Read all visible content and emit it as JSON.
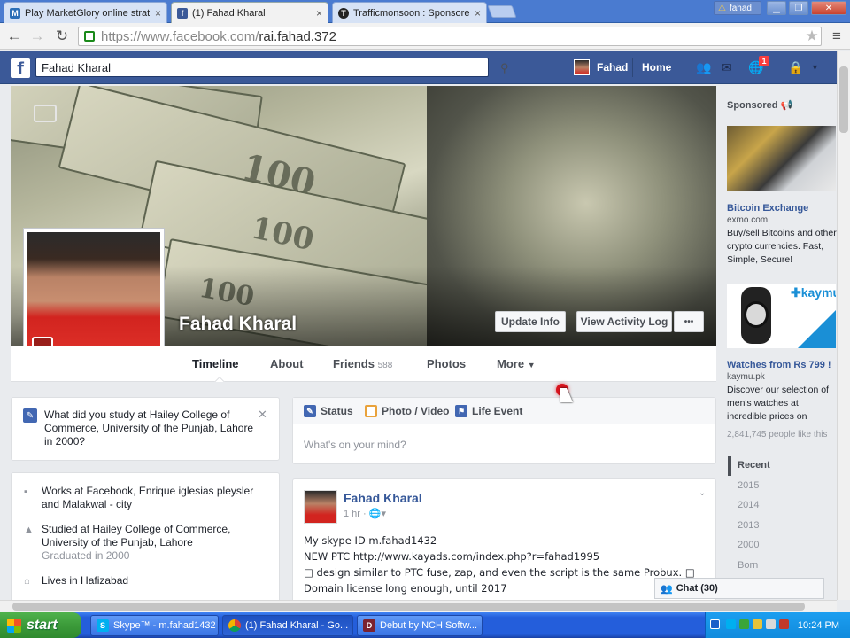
{
  "browser": {
    "tabs": [
      {
        "title": "Play MarketGlory online strat",
        "icon": "marketglory-favicon"
      },
      {
        "title": "(1) Fahad Kharal",
        "icon": "facebook-favicon",
        "active": true
      },
      {
        "title": "Trafficmonsoon : Sponsored",
        "icon": "trafficmonsoon-favicon"
      }
    ],
    "user_badge": "fahad",
    "url_scheme": "https://www.facebook.com/",
    "url_path": "rai.fahad.372"
  },
  "fb": {
    "search_value": "Fahad Kharal",
    "nav_user": "Fahad",
    "nav_home": "Home",
    "notif_count": "1"
  },
  "profile": {
    "name": "Fahad Kharal",
    "update_info": "Update Info",
    "view_activity_log": "View Activity Log",
    "more_dots": "•••",
    "tabs": [
      {
        "label": "Timeline",
        "count": ""
      },
      {
        "label": "About",
        "count": ""
      },
      {
        "label": "Friends",
        "count": "588"
      },
      {
        "label": "Photos",
        "count": ""
      },
      {
        "label": "More",
        "count": ""
      }
    ]
  },
  "intro": {
    "question": "What did you study at Hailey College of Commerce, University of the Punjab, Lahore in 2000?",
    "about": [
      {
        "text": "Works at Facebook, Enrique iglesias pleysler and Malakwal - city",
        "sub": ""
      },
      {
        "text": "Studied at Hailey College of Commerce, University of the Punjab, Lahore",
        "sub": "Graduated in 2000"
      },
      {
        "text": "Lives in Hafizabad",
        "sub": ""
      }
    ]
  },
  "composer": {
    "status": "Status",
    "photo_video": "Photo / Video",
    "life_event": "Life Event",
    "placeholder": "What's on your mind?"
  },
  "post": {
    "author": "Fahad Kharal",
    "time": "1 hr",
    "lines": [
      "My skype ID m.fahad1432",
      "NEW PTC http://www.kayads.com/index.php?r=fahad1995",
      "□ design similar to PTC fuse, zap, and even the script is the same Probux. □",
      "Domain license long enough, until 2017"
    ]
  },
  "rail": {
    "sponsored": "Sponsored",
    "ad1": {
      "title": "Bitcoin Exchange",
      "domain": "exmo.com",
      "body": "Buy/sell Bitcoins and other crypto currencies. Fast, Simple, Secure!"
    },
    "ad2": {
      "brand": "kaymu",
      "title": "Watches from Rs 799 !",
      "domain": "kaymu.pk",
      "body": "Discover our selection of men's watches at incredible prices on Kaymu ! Click here"
    },
    "likes": "2,841,745 people like this",
    "years": [
      "Recent",
      "2015",
      "2014",
      "2013",
      "2000",
      "Born"
    ]
  },
  "chat": {
    "label": "Chat (30)"
  },
  "taskbar": {
    "start": "start",
    "tasks": [
      {
        "title": "Skype™ - m.fahad1432",
        "icon": "skype-icon"
      },
      {
        "title": "(1) Fahad Kharal - Go...",
        "icon": "chrome-icon",
        "active": true
      },
      {
        "title": "Debut by NCH Softw...",
        "icon": "debut-icon"
      }
    ],
    "clock": "10:24 PM"
  }
}
